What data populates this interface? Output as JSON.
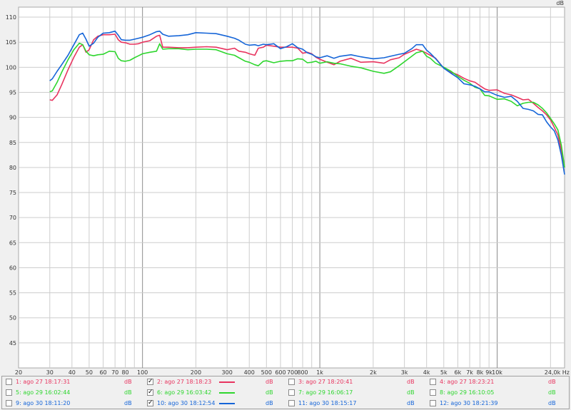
{
  "chart_data": {
    "type": "line",
    "title": "",
    "xlabel": "",
    "ylabel": "",
    "y_unit": "dB",
    "x_unit": "Hz",
    "xscale": "log",
    "xlim": [
      20,
      24000
    ],
    "ylim": [
      40,
      112
    ],
    "grid": true,
    "y_ticks": [
      45,
      50,
      55,
      60,
      65,
      70,
      75,
      80,
      85,
      90,
      95,
      100,
      105,
      110
    ],
    "x_ticks": [
      {
        "value": 20,
        "label": "20"
      },
      {
        "value": 30,
        "label": "30"
      },
      {
        "value": 40,
        "label": "40"
      },
      {
        "value": 50,
        "label": "50"
      },
      {
        "value": 60,
        "label": "60"
      },
      {
        "value": 70,
        "label": "70"
      },
      {
        "value": 80,
        "label": "80"
      },
      {
        "value": 100,
        "label": "100"
      },
      {
        "value": 200,
        "label": "200"
      },
      {
        "value": 300,
        "label": "300"
      },
      {
        "value": 400,
        "label": "400"
      },
      {
        "value": 500,
        "label": "500"
      },
      {
        "value": 600,
        "label": "600"
      },
      {
        "value": 700,
        "label": "700"
      },
      {
        "value": 800,
        "label": "800"
      },
      {
        "value": 1000,
        "label": "1k"
      },
      {
        "value": 2000,
        "label": "2k"
      },
      {
        "value": 3000,
        "label": "3k"
      },
      {
        "value": 4000,
        "label": "4k"
      },
      {
        "value": 5000,
        "label": "5k"
      },
      {
        "value": 6000,
        "label": "6k"
      },
      {
        "value": 7000,
        "label": "7k"
      },
      {
        "value": 8000,
        "label": "8k"
      },
      {
        "value": 9000,
        "label": "9k"
      },
      {
        "value": 10000,
        "label": "10k"
      },
      {
        "value": 24000,
        "label": "24,0k Hz"
      }
    ],
    "series": [
      {
        "name": "2: ago 27 18:18:23",
        "color": "#e8345f",
        "x": [
          30,
          31,
          33,
          35,
          38,
          41,
          44,
          46,
          48,
          50,
          53,
          56,
          60,
          65,
          70,
          73,
          76,
          80,
          85,
          90,
          95,
          100,
          110,
          120,
          125,
          130,
          140,
          160,
          180,
          200,
          230,
          260,
          300,
          330,
          350,
          380,
          400,
          430,
          450,
          480,
          500,
          550,
          600,
          650,
          700,
          750,
          800,
          850,
          900,
          950,
          1000,
          1100,
          1200,
          1300,
          1500,
          1700,
          2000,
          2300,
          2500,
          2800,
          3000,
          3300,
          3500,
          3800,
          4000,
          4200,
          4500,
          5000,
          5500,
          6000,
          6500,
          7000,
          7500,
          8000,
          8500,
          9000,
          10000,
          11000,
          12000,
          13000,
          14000,
          15000,
          16000,
          17000,
          18000,
          19000,
          20000,
          21000,
          22000,
          23000,
          24000
        ],
        "y": [
          93.5,
          93.4,
          94.5,
          96.5,
          99.5,
          102,
          104,
          104.5,
          103,
          103.5,
          105.5,
          106.2,
          106.5,
          106.5,
          106.6,
          105.5,
          105,
          104.9,
          104.6,
          104.6,
          104.7,
          105,
          105.3,
          106.2,
          106.4,
          104,
          104,
          103.9,
          103.9,
          104,
          104.1,
          104,
          103.5,
          103.8,
          103.2,
          103,
          102.7,
          102.4,
          103.8,
          104,
          104.4,
          104.2,
          104,
          104,
          104,
          103.8,
          102.8,
          103,
          102.7,
          102,
          101.6,
          101,
          100.5,
          101.2,
          101.8,
          101,
          101.1,
          100.8,
          101.5,
          101.9,
          102.6,
          103.2,
          103.6,
          103.2,
          102.8,
          102.4,
          101.8,
          99.8,
          99,
          98.5,
          97.8,
          97.3,
          97,
          96.3,
          95.7,
          95.4,
          95.5,
          94.8,
          94.5,
          94,
          93.5,
          93.6,
          92.8,
          92,
          91.3,
          90.5,
          89.5,
          88,
          86.5,
          83.5,
          80
        ]
      },
      {
        "name": "6: ago 29 16:03:42",
        "color": "#2ed62e",
        "x": [
          30,
          31,
          33,
          35,
          38,
          41,
          44,
          46,
          48,
          50,
          53,
          56,
          60,
          65,
          70,
          73,
          76,
          80,
          85,
          90,
          95,
          100,
          110,
          120,
          125,
          130,
          140,
          160,
          180,
          200,
          230,
          260,
          300,
          330,
          350,
          380,
          400,
          430,
          450,
          480,
          500,
          550,
          600,
          650,
          700,
          750,
          800,
          850,
          900,
          950,
          1000,
          1100,
          1200,
          1300,
          1500,
          1700,
          2000,
          2300,
          2500,
          2800,
          3000,
          3300,
          3500,
          3800,
          4000,
          4200,
          4500,
          5000,
          5500,
          6000,
          6500,
          7000,
          7500,
          8000,
          8500,
          9000,
          10000,
          11000,
          12000,
          13000,
          14000,
          15000,
          16000,
          17000,
          18000,
          19000,
          20000,
          21000,
          22000,
          23000,
          24000
        ],
        "y": [
          95.1,
          95.3,
          97,
          99,
          101.5,
          103.5,
          104.8,
          104.5,
          103.2,
          102.5,
          102.3,
          102.5,
          102.6,
          103.2,
          103.1,
          101.8,
          101.3,
          101.2,
          101.4,
          101.9,
          102.3,
          102.7,
          103,
          103.2,
          104.7,
          103.6,
          103.7,
          103.7,
          103.5,
          103.6,
          103.6,
          103.5,
          102.7,
          102.4,
          101.9,
          101.2,
          101.0,
          100.5,
          100.3,
          101.2,
          101.3,
          100.9,
          101.2,
          101.3,
          101.3,
          101.7,
          101.6,
          100.9,
          101,
          101.2,
          100.8,
          101.1,
          100.8,
          100.7,
          100.2,
          99.9,
          99.2,
          98.8,
          99.1,
          100.3,
          101.1,
          102.2,
          102.9,
          103.2,
          102.2,
          101.8,
          100.8,
          100,
          99.2,
          98.2,
          97.4,
          96.8,
          96,
          95.7,
          94.4,
          94.3,
          93.6,
          93.7,
          93.2,
          92.3,
          92.8,
          93,
          93,
          92.5,
          91.8,
          90.9,
          89.8,
          88.7,
          87.5,
          84.5,
          80
        ]
      },
      {
        "name": "10: ago 30 18:12:54",
        "color": "#1565d8",
        "x": [
          30,
          31,
          33,
          35,
          38,
          41,
          44,
          46,
          48,
          50,
          53,
          56,
          60,
          65,
          70,
          73,
          76,
          80,
          85,
          90,
          95,
          100,
          110,
          120,
          125,
          130,
          140,
          160,
          180,
          200,
          230,
          260,
          300,
          330,
          350,
          380,
          400,
          430,
          450,
          480,
          500,
          550,
          600,
          650,
          700,
          750,
          800,
          850,
          900,
          950,
          1000,
          1100,
          1200,
          1300,
          1500,
          1700,
          2000,
          2300,
          2500,
          2800,
          3000,
          3300,
          3500,
          3800,
          4000,
          4200,
          4500,
          5000,
          5500,
          6000,
          6500,
          7000,
          7500,
          8000,
          8500,
          9000,
          10000,
          11000,
          12000,
          13000,
          14000,
          15000,
          16000,
          17000,
          18000,
          19000,
          20000,
          21000,
          22000,
          23000,
          24000
        ],
        "y": [
          97.3,
          97.7,
          99.2,
          100.5,
          102.4,
          104.5,
          106.5,
          106.8,
          105.6,
          104.2,
          104.8,
          106,
          106.8,
          106.9,
          107.2,
          106.4,
          105.5,
          105.4,
          105.4,
          105.6,
          105.8,
          106,
          106.5,
          107.1,
          107.2,
          106.6,
          106.2,
          106.3,
          106.5,
          106.9,
          106.8,
          106.7,
          106.2,
          105.8,
          105.4,
          104.6,
          104.4,
          104.5,
          104.3,
          104.6,
          104.5,
          104.7,
          103.7,
          104.1,
          104.7,
          103.9,
          103.6,
          102.9,
          102.6,
          102.1,
          101.9,
          102.3,
          101.8,
          102.2,
          102.5,
          102.1,
          101.7,
          101.9,
          102.2,
          102.6,
          102.8,
          103.7,
          104.5,
          104.5,
          103.4,
          102.8,
          101.7,
          99.8,
          98.8,
          97.9,
          96.7,
          96.5,
          96.2,
          95.7,
          95.1,
          95.1,
          94.4,
          94,
          94.2,
          93.2,
          91.8,
          91.6,
          91.3,
          90.6,
          90.5,
          89.1,
          88.1,
          87.3,
          85.5,
          82.5,
          78.6
        ]
      }
    ]
  },
  "legend": {
    "unit_label": "dB",
    "items": [
      {
        "label": "1: ago 27 18:17:31",
        "color": "#e8345f",
        "checked": false
      },
      {
        "label": "2: ago 27 18:18:23",
        "color": "#e8345f",
        "checked": true
      },
      {
        "label": "3: ago 27 18:20:41",
        "color": "#e8345f",
        "checked": false
      },
      {
        "label": "4: ago 27 18:23:21",
        "color": "#e8345f",
        "checked": false
      },
      {
        "label": "5: ago 29 16:02:44",
        "color": "#2ed62e",
        "checked": false
      },
      {
        "label": "6: ago 29 16:03:42",
        "color": "#2ed62e",
        "checked": true
      },
      {
        "label": "7: ago 29 16:06:17",
        "color": "#2ed62e",
        "checked": false
      },
      {
        "label": "8: ago 29 16:10:05",
        "color": "#2ed62e",
        "checked": false
      },
      {
        "label": "9: ago 30 18:11:20",
        "color": "#1565d8",
        "checked": false
      },
      {
        "label": "10: ago 30 18:12:54",
        "color": "#1565d8",
        "checked": true
      },
      {
        "label": "11: ago 30 18:15:17",
        "color": "#1565d8",
        "checked": false
      },
      {
        "label": "12: ago 30 18:21:39",
        "color": "#1565d8",
        "checked": false
      }
    ]
  }
}
